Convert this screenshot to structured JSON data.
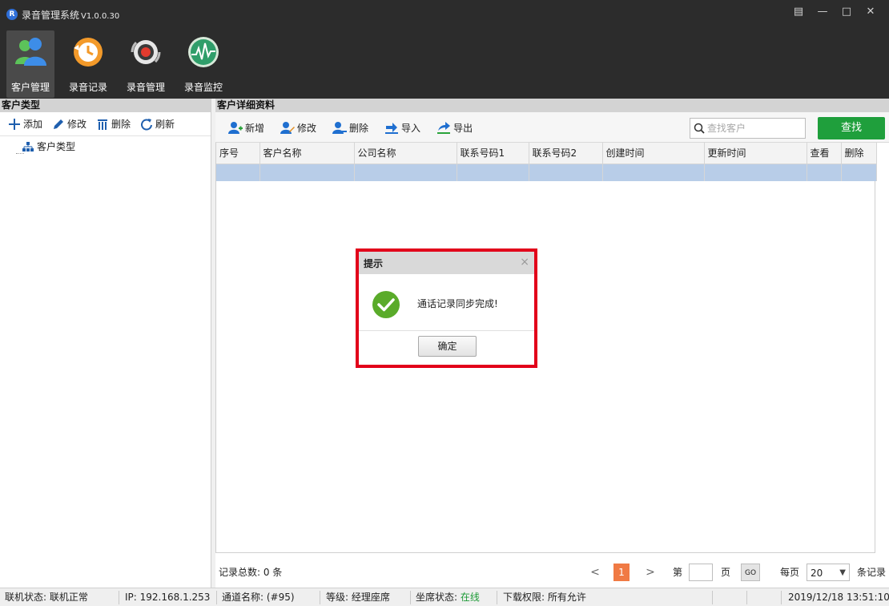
{
  "app": {
    "logo_letter": "R",
    "title": "录音管理系统",
    "version": "V1.0.0.30"
  },
  "window_controls": {
    "menu": "▤",
    "minimize": "—",
    "maximize": "□",
    "close": "✕"
  },
  "nav": {
    "items": [
      {
        "label": "客户管理",
        "icon": "users-icon",
        "active": true
      },
      {
        "label": "录音记录",
        "icon": "history-clock-icon",
        "active": false
      },
      {
        "label": "录音管理",
        "icon": "record-disc-icon",
        "active": false
      },
      {
        "label": "录音监控",
        "icon": "waveform-monitor-icon",
        "active": false
      }
    ]
  },
  "left": {
    "header": "客户类型",
    "toolbar": {
      "add": "添加",
      "edit": "修改",
      "delete": "删除",
      "refresh": "刷新"
    },
    "tree_root": "客户类型"
  },
  "right": {
    "header": "客户详细资料",
    "toolbar": {
      "new": "新增",
      "edit": "修改",
      "delete": "删除",
      "import": "导入",
      "export": "导出"
    },
    "search_placeholder": "查找客户",
    "search_button": "查找",
    "columns": [
      "序号",
      "客户名称",
      "公司名称",
      "联系号码1",
      "联系号码2",
      "创建时间",
      "更新时间",
      "查看",
      "删除"
    ],
    "selected_row_empty": true
  },
  "pager": {
    "record_count": "记录总数: 0 条",
    "prev": "<",
    "current_page": "1",
    "next": ">",
    "page_prefix": "第",
    "page_input": "",
    "page_suffix": "页",
    "go": "GO",
    "per_page_label": "每页",
    "page_size": "20",
    "records_label": "条记录"
  },
  "status": {
    "conn_label": "联机状态:",
    "conn_value": "联机正常",
    "ip": "IP: 192.168.1.253",
    "channel": "通道名称: (#95)",
    "level": "等级: 经理座席",
    "seat_label": "坐席状态:",
    "seat_value": "在线",
    "download": "下载权限: 所有允许",
    "datetime": "2019/12/18 13:51:10"
  },
  "dialog": {
    "title": "提示",
    "close": "×",
    "message": "通话记录同步完成!",
    "ok": "确定"
  },
  "colors": {
    "dark_bg": "#2c2c2c",
    "selected_row": "#b8cde8",
    "search_button": "#1f9f3c",
    "current_page": "#f07a44",
    "highlight_border": "#e2001a",
    "online": "#1d9b37",
    "success_icon": "#5aab2a"
  }
}
